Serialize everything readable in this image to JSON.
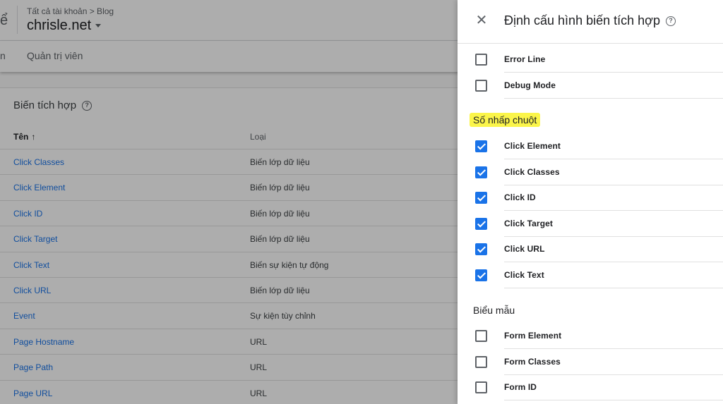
{
  "header": {
    "cut_text": "ể",
    "breadcrumb": "Tất cả tài khoản > Blog",
    "container_name": "chrisle.net"
  },
  "subnav": {
    "cut_text": "n",
    "admin": "Quản trị viên"
  },
  "builtin_table": {
    "title": "Biến tích hợp",
    "col_name": "Tên",
    "col_type": "Loại",
    "rows": [
      {
        "name": "Click Classes",
        "type": "Biến lớp dữ liệu"
      },
      {
        "name": "Click Element",
        "type": "Biến lớp dữ liệu"
      },
      {
        "name": "Click ID",
        "type": "Biến lớp dữ liệu"
      },
      {
        "name": "Click Target",
        "type": "Biến lớp dữ liệu"
      },
      {
        "name": "Click Text",
        "type": "Biến sự kiện tự động"
      },
      {
        "name": "Click URL",
        "type": "Biến lớp dữ liệu"
      },
      {
        "name": "Event",
        "type": "Sự kiện tùy chỉnh"
      },
      {
        "name": "Page Hostname",
        "type": "URL"
      },
      {
        "name": "Page Path",
        "type": "URL"
      },
      {
        "name": "Page URL",
        "type": "URL"
      }
    ]
  },
  "panel": {
    "title": "Định cấu hình biến tích hợp",
    "top_items": [
      {
        "label": "Error Line",
        "checked": false
      },
      {
        "label": "Debug Mode",
        "checked": false
      }
    ],
    "clicks_section": "Số nhấp chuột",
    "click_items": [
      {
        "label": "Click Element",
        "checked": true
      },
      {
        "label": "Click Classes",
        "checked": true
      },
      {
        "label": "Click ID",
        "checked": true
      },
      {
        "label": "Click Target",
        "checked": true
      },
      {
        "label": "Click URL",
        "checked": true
      },
      {
        "label": "Click Text",
        "checked": true
      }
    ],
    "forms_section": "Biểu mẫu",
    "form_items": [
      {
        "label": "Form Element",
        "checked": false
      },
      {
        "label": "Form Classes",
        "checked": false
      },
      {
        "label": "Form ID",
        "checked": false
      }
    ]
  },
  "colors": {
    "accent": "#1a73e8",
    "highlight": "#fbf54a"
  }
}
